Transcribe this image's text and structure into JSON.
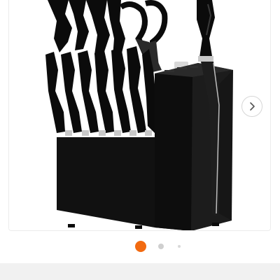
{
  "gallery": {
    "image": {
      "subject": "knife-block-set-image",
      "colors": {
        "knife": "#0b0b0b",
        "block": "#111111",
        "steel": "#c9c9c9",
        "highlight": "#3a3a3a"
      }
    },
    "next_arrow_icon": "chevron-right-icon",
    "pager": {
      "total": 3,
      "active_index": 0,
      "active_color": "#f26a10",
      "inactive_color": "#cfcfcf"
    }
  }
}
